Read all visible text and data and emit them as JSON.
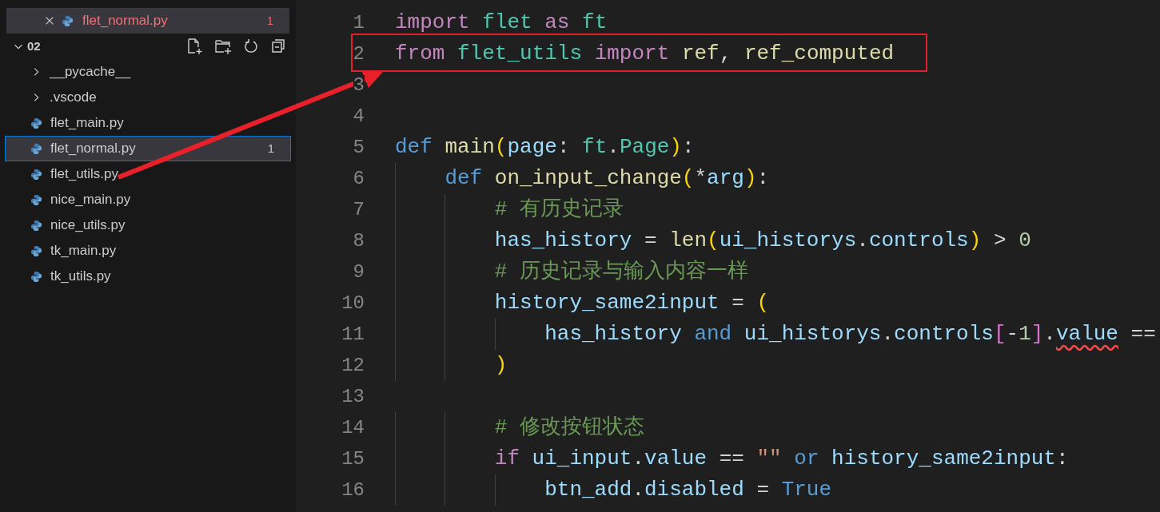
{
  "explorer": {
    "open_editors": [
      {
        "name": "flet_normal.py",
        "problems": "1",
        "selected": true
      }
    ],
    "folder": {
      "name": "02",
      "expanded": true,
      "children": [
        {
          "kind": "folder",
          "name": "__pycache__",
          "expanded": false,
          "selected": false
        },
        {
          "kind": "folder",
          "name": ".vscode",
          "expanded": false,
          "selected": false
        },
        {
          "kind": "file",
          "name": "flet_main.py",
          "selected": false
        },
        {
          "kind": "file",
          "name": "flet_normal.py",
          "selected": true,
          "problems": "1"
        },
        {
          "kind": "file",
          "name": "flet_utils.py",
          "selected": false
        },
        {
          "kind": "file",
          "name": "nice_main.py",
          "selected": false
        },
        {
          "kind": "file",
          "name": "nice_utils.py",
          "selected": false
        },
        {
          "kind": "file",
          "name": "tk_main.py",
          "selected": false
        },
        {
          "kind": "file",
          "name": "tk_utils.py",
          "selected": false
        }
      ]
    }
  },
  "editor": {
    "lines": [
      {
        "number": "1",
        "boxed": false,
        "tokens": [
          {
            "text": "import ",
            "kind": "keyword"
          },
          {
            "text": "flet ",
            "kind": "module"
          },
          {
            "text": "as ",
            "kind": "keyword"
          },
          {
            "text": "ft",
            "kind": "module"
          }
        ]
      },
      {
        "number": "2",
        "boxed": true,
        "tokens": [
          {
            "text": "from ",
            "kind": "keyword"
          },
          {
            "text": "flet_utils ",
            "kind": "module"
          },
          {
            "text": "import ",
            "kind": "keyword"
          },
          {
            "text": "ref",
            "kind": "function"
          },
          {
            "text": ", ",
            "kind": "plain"
          },
          {
            "text": "ref_computed",
            "kind": "function"
          }
        ]
      },
      {
        "number": "3",
        "boxed": false
      },
      {
        "number": "4",
        "boxed": false
      },
      {
        "number": "5",
        "boxed": false,
        "tokens": [
          {
            "text": "def ",
            "kind": "storage"
          },
          {
            "text": "main",
            "kind": "function"
          },
          {
            "text": "(",
            "kind": "bracket1"
          },
          {
            "text": "page",
            "kind": "variable"
          },
          {
            "text": ": ",
            "kind": "plain"
          },
          {
            "text": "ft",
            "kind": "module"
          },
          {
            "text": ".",
            "kind": "plain"
          },
          {
            "text": "Page",
            "kind": "module"
          },
          {
            "text": ")",
            "kind": "bracket1"
          },
          {
            "text": ":",
            "kind": "plain"
          }
        ],
        "children": [
          {
            "number": "6",
            "boxed": false,
            "tokens": [
              {
                "text": "def ",
                "kind": "storage"
              },
              {
                "text": "on_input_change",
                "kind": "function"
              },
              {
                "text": "(",
                "kind": "bracket1"
              },
              {
                "text": "*",
                "kind": "plain"
              },
              {
                "text": "arg",
                "kind": "variable"
              },
              {
                "text": ")",
                "kind": "bracket1"
              },
              {
                "text": ":",
                "kind": "plain"
              }
            ],
            "children": [
              {
                "number": "7",
                "boxed": false,
                "tokens": [
                  {
                    "text": "# 有历史记录",
                    "kind": "comment"
                  }
                ]
              },
              {
                "number": "8",
                "boxed": false,
                "tokens": [
                  {
                    "text": "has_history ",
                    "kind": "variable"
                  },
                  {
                    "text": "= ",
                    "kind": "plain"
                  },
                  {
                    "text": "len",
                    "kind": "function"
                  },
                  {
                    "text": "(",
                    "kind": "bracket1"
                  },
                  {
                    "text": "ui_historys",
                    "kind": "variable"
                  },
                  {
                    "text": ".",
                    "kind": "plain"
                  },
                  {
                    "text": "controls",
                    "kind": "variable"
                  },
                  {
                    "text": ")",
                    "kind": "bracket1"
                  },
                  {
                    "text": " > ",
                    "kind": "plain"
                  },
                  {
                    "text": "0",
                    "kind": "number"
                  }
                ]
              },
              {
                "number": "9",
                "boxed": false,
                "tokens": [
                  {
                    "text": "# 历史记录与输入内容一样",
                    "kind": "comment"
                  }
                ]
              },
              {
                "number": "10",
                "boxed": false,
                "tokens": [
                  {
                    "text": "history_same2input ",
                    "kind": "variable"
                  },
                  {
                    "text": "= ",
                    "kind": "plain"
                  },
                  {
                    "text": "(",
                    "kind": "bracket1"
                  }
                ],
                "children": [
                  {
                    "number": "11",
                    "boxed": false,
                    "tokens": [
                      {
                        "text": "has_history ",
                        "kind": "variable"
                      },
                      {
                        "text": "and ",
                        "kind": "storage"
                      },
                      {
                        "text": "ui_historys",
                        "kind": "variable"
                      },
                      {
                        "text": ".",
                        "kind": "plain"
                      },
                      {
                        "text": "controls",
                        "kind": "variable"
                      },
                      {
                        "text": "[",
                        "kind": "bracket2"
                      },
                      {
                        "text": "-",
                        "kind": "plain"
                      },
                      {
                        "text": "1",
                        "kind": "number"
                      },
                      {
                        "text": "]",
                        "kind": "bracket2"
                      },
                      {
                        "text": ".",
                        "kind": "plain"
                      },
                      {
                        "text": "value",
                        "kind": "variable",
                        "squiggle": true
                      },
                      {
                        "text": " ==",
                        "kind": "plain"
                      }
                    ]
                  }
                ]
              },
              {
                "number": "12",
                "boxed": false,
                "tokens": [
                  {
                    "text": ")",
                    "kind": "bracket1"
                  }
                ]
              },
              {
                "number": "13",
                "boxed": false
              },
              {
                "number": "14",
                "boxed": false,
                "tokens": [
                  {
                    "text": "# 修改按钮状态",
                    "kind": "comment"
                  }
                ]
              },
              {
                "number": "15",
                "boxed": false,
                "tokens": [
                  {
                    "text": "if ",
                    "kind": "keyword"
                  },
                  {
                    "text": "ui_input",
                    "kind": "variable"
                  },
                  {
                    "text": ".",
                    "kind": "plain"
                  },
                  {
                    "text": "value",
                    "kind": "variable"
                  },
                  {
                    "text": " == ",
                    "kind": "plain"
                  },
                  {
                    "text": "\"\"",
                    "kind": "string"
                  },
                  {
                    "text": " or ",
                    "kind": "storage"
                  },
                  {
                    "text": "history_same2input",
                    "kind": "variable"
                  },
                  {
                    "text": ":",
                    "kind": "plain"
                  }
                ],
                "children": [
                  {
                    "number": "16",
                    "boxed": false,
                    "tokens": [
                      {
                        "text": "btn_add",
                        "kind": "variable"
                      },
                      {
                        "text": ".",
                        "kind": "plain"
                      },
                      {
                        "text": "disabled",
                        "kind": "variable"
                      },
                      {
                        "text": " = ",
                        "kind": "plain"
                      },
                      {
                        "text": "True",
                        "kind": "storage"
                      }
                    ]
                  }
                ]
              }
            ]
          }
        ]
      }
    ]
  }
}
